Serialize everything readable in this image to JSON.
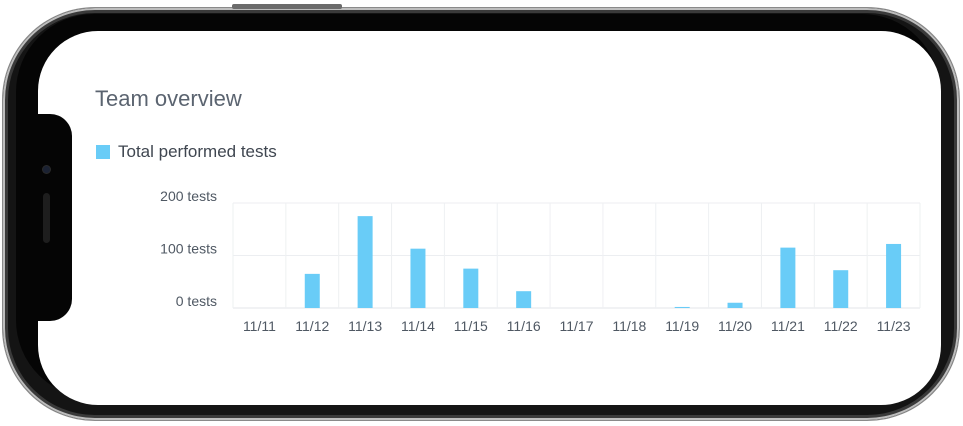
{
  "header": {
    "title": "Team overview"
  },
  "legend": {
    "label": "Total performed tests",
    "color": "#69ccf7"
  },
  "chart_data": {
    "type": "bar",
    "categories": [
      "11/11",
      "11/12",
      "11/13",
      "11/14",
      "11/15",
      "11/16",
      "11/17",
      "11/18",
      "11/19",
      "11/20",
      "11/21",
      "11/22",
      "11/23"
    ],
    "series": [
      {
        "name": "Total performed tests",
        "values": [
          0,
          65,
          175,
          113,
          75,
          32,
          0,
          0,
          2,
          10,
          115,
          72,
          122
        ]
      }
    ],
    "y_ticks": [
      "200 tests",
      "100 tests",
      "0 tests"
    ],
    "ylim": [
      0,
      200
    ],
    "grid": true,
    "legend_position": "top-left",
    "bar_color": "#69ccf7"
  }
}
